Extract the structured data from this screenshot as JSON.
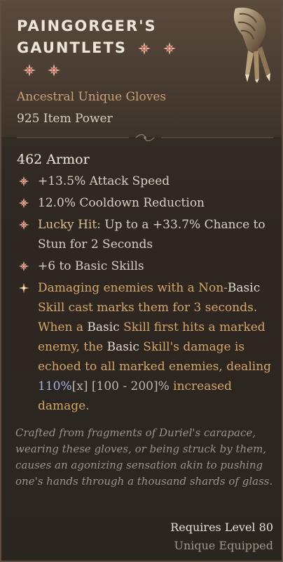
{
  "item": {
    "title_line1": "PAINGORGER'S",
    "title_line2": "GAUNTLETS",
    "subtype": "Ancestral Unique Gloves",
    "item_power": "925 Item Power",
    "armor": "462 Armor",
    "gem_icon": "star-gem-icon",
    "gauntlet_icon": "gauntlet-icon"
  },
  "affixes": [
    {
      "text": "+13.5% Attack Speed"
    },
    {
      "text": "12.0% Cooldown Reduction"
    },
    {
      "label": "Lucky Hit:",
      "text": " Up to a +33.7% Chance to Stun for 2 Seconds"
    },
    {
      "text": "+6 to Basic Skills"
    }
  ],
  "legendary": {
    "p1": "Damaging enemies with a Non-",
    "basic1": "Basic",
    "p2": " Skill cast marks them for 3 seconds. When a ",
    "basic2": "Basic",
    "p3": " Skill first hits a marked enemy, the ",
    "basic3": "Basic",
    "p4": " Skill's damage is echoed to all marked enemies, dealing ",
    "value": "110%",
    "bracket_x": "[x]",
    "range": " [100 - 200]%",
    "p5": " increased damage."
  },
  "flavor": "Crafted from fragments of Duriel's carapace, wearing these gloves, or being struck by them, causes an agonizing sensation akin to pushing one's hands through a thousand shards of glass.",
  "requires": "Requires Level 80",
  "equipped": "Unique Equipped",
  "colors": {
    "unique": "#c9a176",
    "legendary_text": "#d6a668",
    "highlight": "#a8aee8",
    "background": "#2f2822"
  }
}
